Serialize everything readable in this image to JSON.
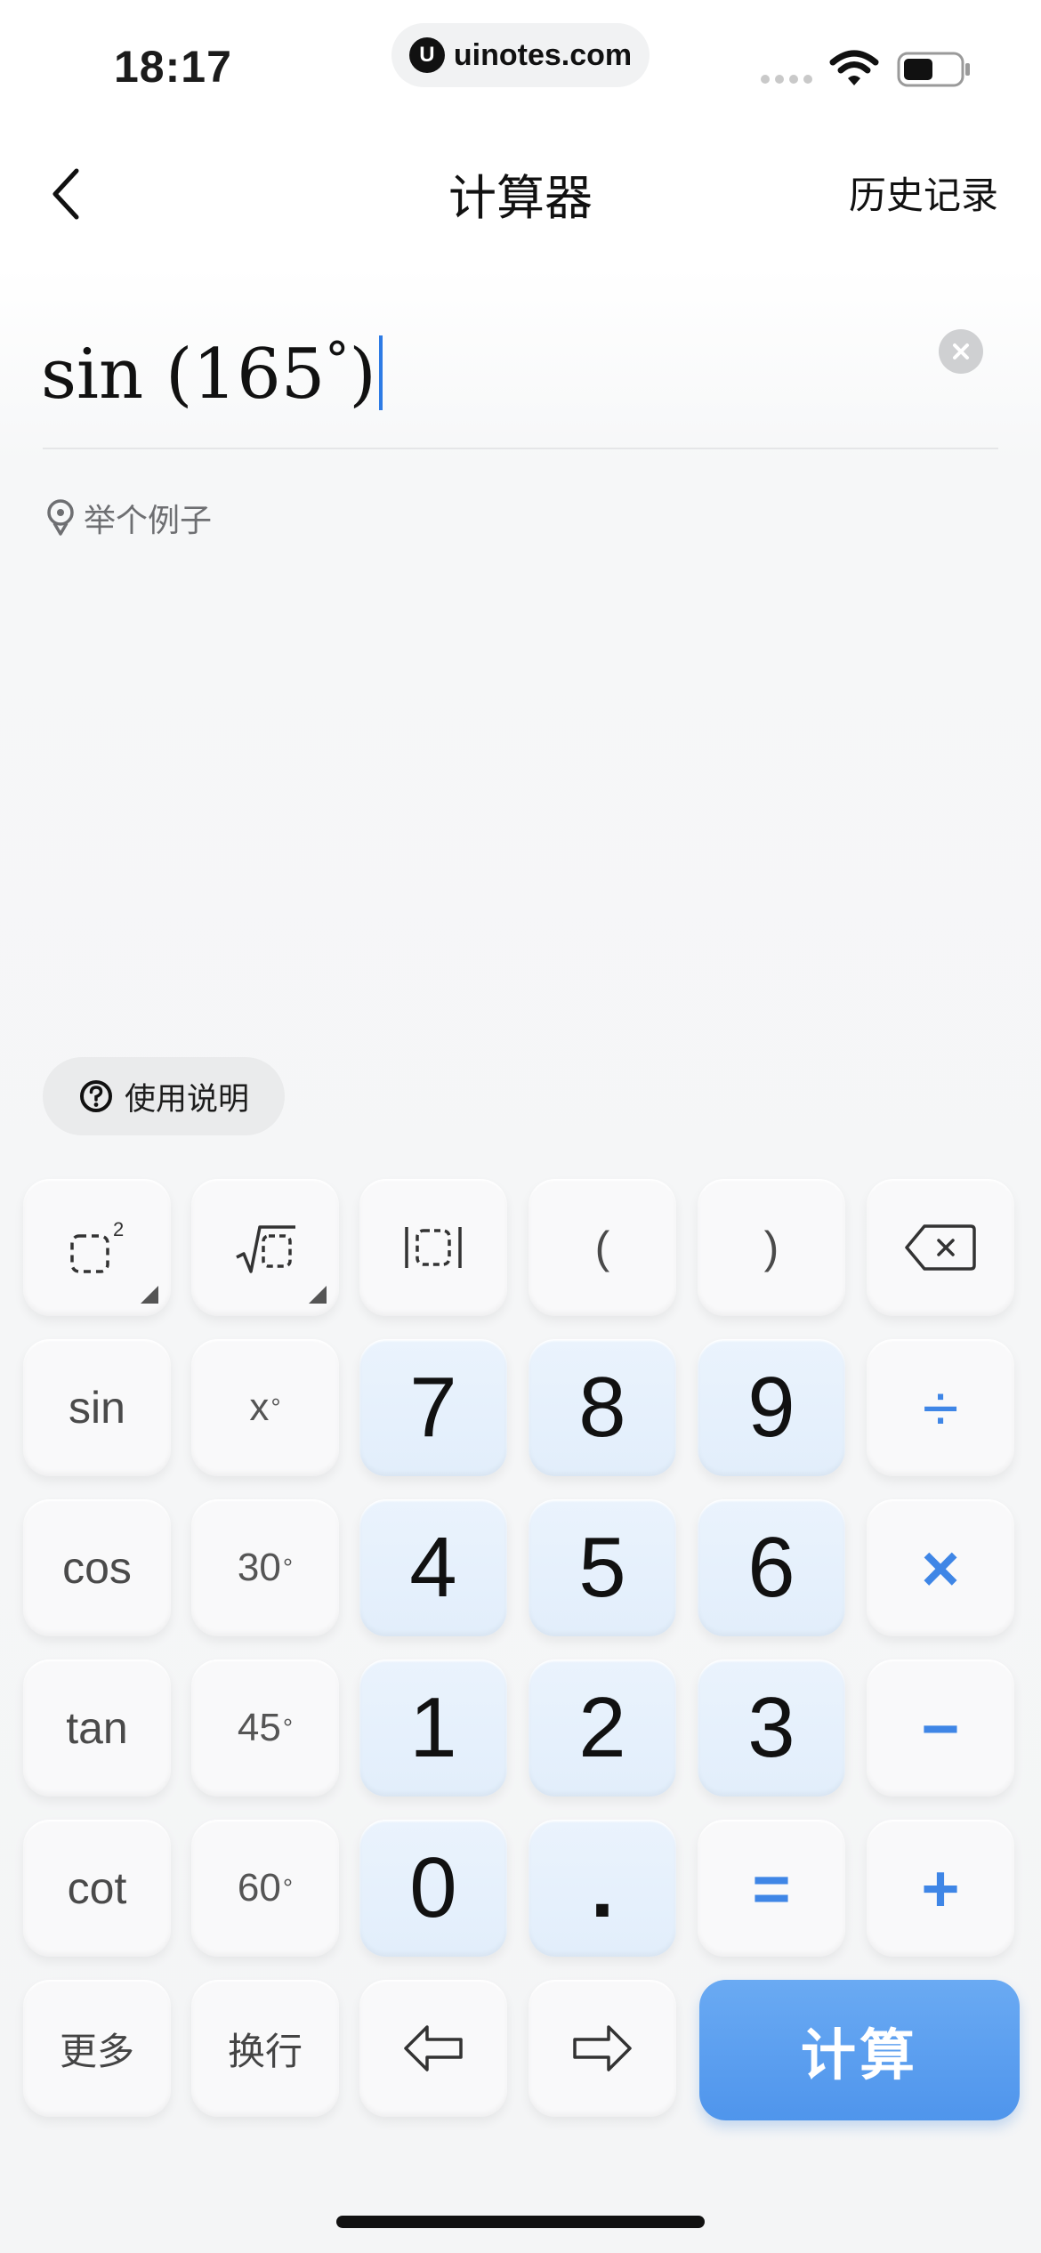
{
  "status_bar": {
    "time": "18:17",
    "url": "uinotes.com",
    "url_logo": "U"
  },
  "nav": {
    "title": "计算器",
    "history": "历史记录"
  },
  "expression": {
    "func": "sin",
    "open_paren": "(",
    "number": "165",
    "degree": "°",
    "close_paren": ")"
  },
  "example_hint": "举个例子",
  "help": "使用说明",
  "keys": {
    "paren_open": "(",
    "paren_close": ")",
    "sin": "sin",
    "cos": "cos",
    "tan": "tan",
    "cot": "cot",
    "x_deg": "x",
    "deg30": "30",
    "deg45": "45",
    "deg60": "60",
    "degree_symbol": "°",
    "square_sup": "2",
    "n7": "7",
    "n8": "8",
    "n9": "9",
    "n4": "4",
    "n5": "5",
    "n6": "6",
    "n1": "1",
    "n2": "2",
    "n3": "3",
    "n0": "0",
    "dot": ".",
    "divide": "÷",
    "multiply": "×",
    "minus": "−",
    "plus": "+",
    "equals": "=",
    "more": "更多",
    "newline": "换行",
    "calculate": "计算"
  },
  "colors": {
    "accent": "#3f86e6",
    "cursor": "#2d7be5",
    "calc_button": "#5a9ff0",
    "number_key": "#e6f0fc"
  }
}
